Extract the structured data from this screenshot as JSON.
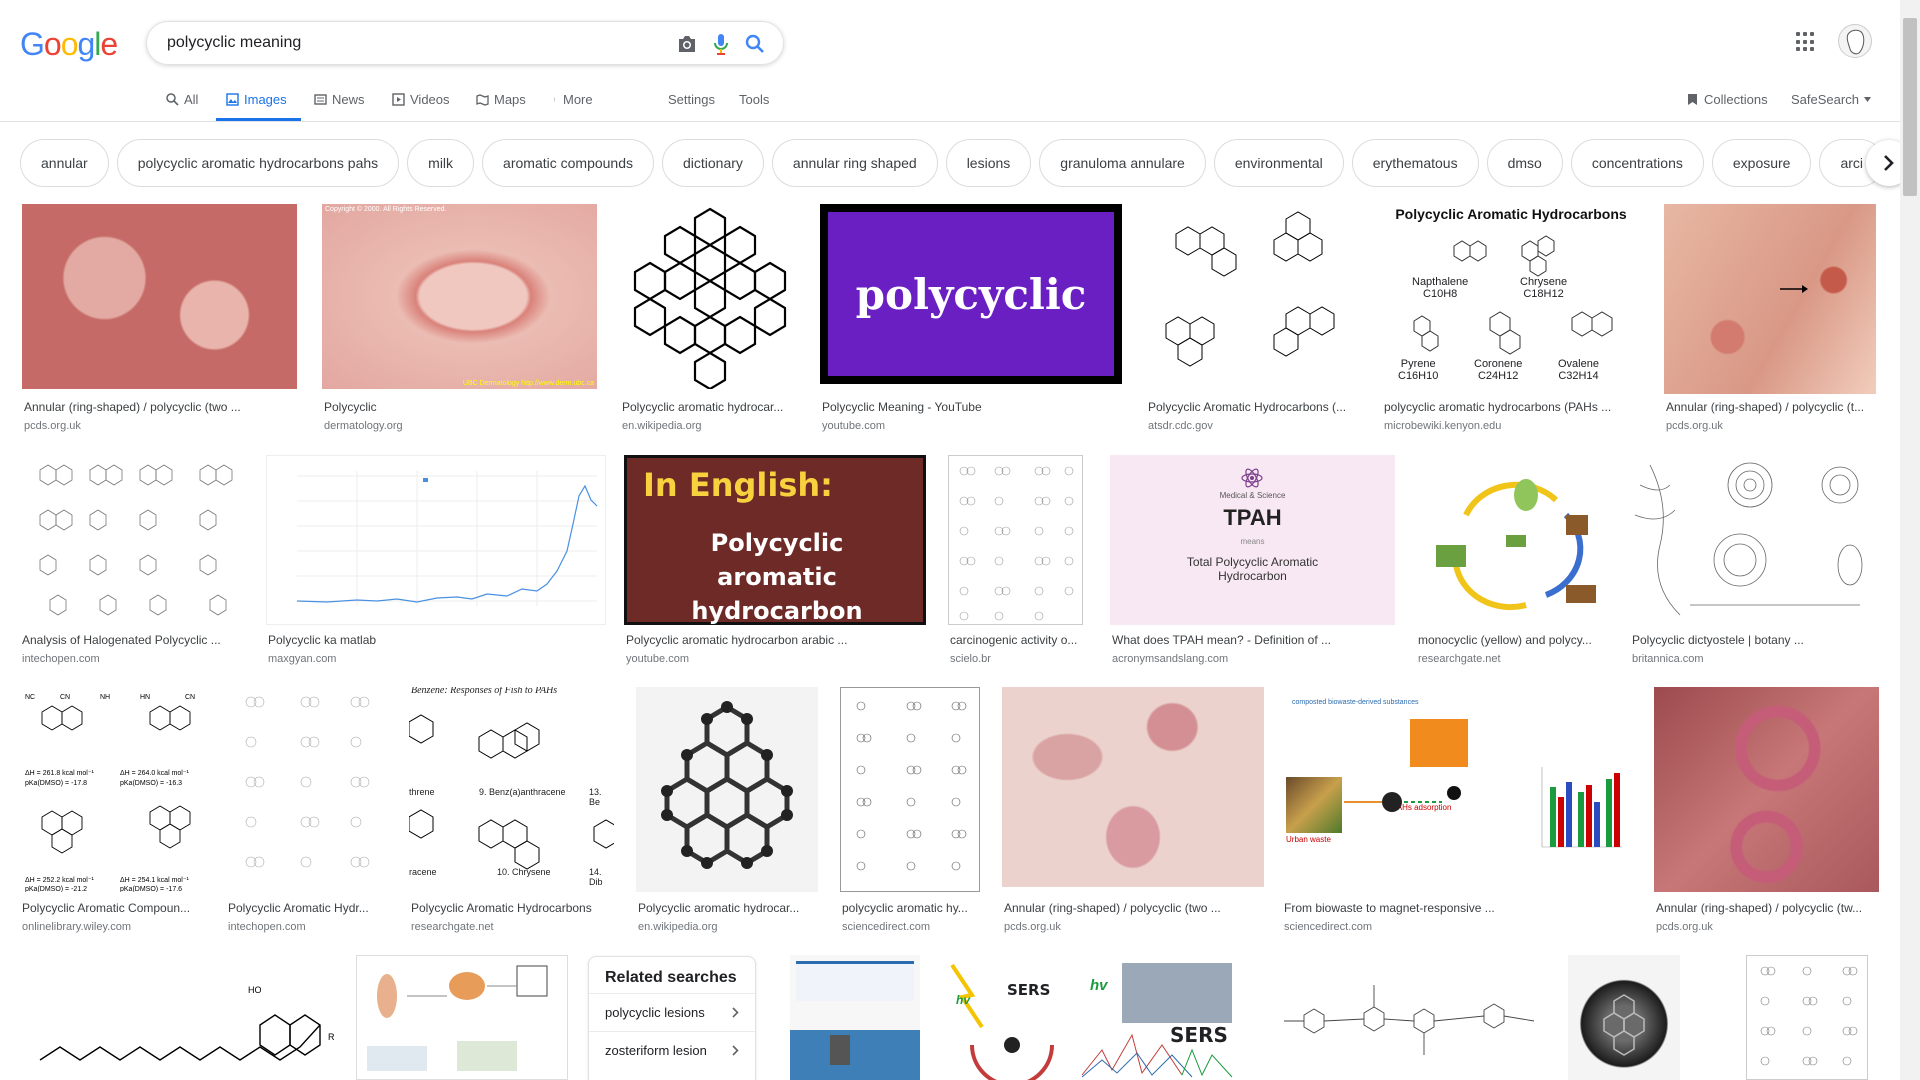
{
  "search": {
    "query": "polycyclic meaning"
  },
  "logo": {
    "letters": [
      "G",
      "o",
      "o",
      "g",
      "l",
      "e"
    ],
    "colors": [
      "#4285f4",
      "#ea4335",
      "#fbbc05",
      "#4285f4",
      "#34a853",
      "#ea4335"
    ]
  },
  "nav": {
    "tabs": [
      "All",
      "Images",
      "News",
      "Videos",
      "Maps",
      "More"
    ],
    "settings": "Settings",
    "tools": "Tools",
    "collections": "Collections",
    "safesearch": "SafeSearch"
  },
  "chips": [
    "annular",
    "polycyclic aromatic hydrocarbons pahs",
    "milk",
    "aromatic compounds",
    "dictionary",
    "annular ring shaped",
    "lesions",
    "granuloma annulare",
    "environmental",
    "erythematous",
    "dmso",
    "concentrations",
    "exposure",
    "arci"
  ],
  "results": [
    {
      "title": "Annular (ring-shaped) / polycyclic (two ...",
      "source": "pcds.org.uk"
    },
    {
      "title": "Polycyclic",
      "source": "dermatology.org",
      "overlay": "Copyright © 2000. All Rights Reserved.",
      "overlay2": "UBC Dermatology http://www.derm.ubc.ca"
    },
    {
      "title": "Polycyclic aromatic hydrocar...",
      "source": "en.wikipedia.org"
    },
    {
      "title": "Polycyclic Meaning - YouTube",
      "source": "youtube.com",
      "overlay": "polycyclic"
    },
    {
      "title": "Polycyclic Aromatic Hydrocarbons (...",
      "source": "atsdr.cdc.gov"
    },
    {
      "title": "polycyclic aromatic hydrocarbons (PAHs ...",
      "source": "microbewiki.kenyon.edu",
      "overlay": "Polycyclic Aromatic Hydrocarbons",
      "labels": [
        "Napthalene",
        "C10H8",
        "Chrysene",
        "C18H12",
        "Pyrene",
        "C16H10",
        "Coronene",
        "C24H12",
        "Ovalene",
        "C32H14"
      ]
    },
    {
      "title": "Annular (ring-shaped) / polycyclic (t...",
      "source": "pcds.org.uk"
    },
    {
      "title": "Analysis of Halogenated Polycyclic ...",
      "source": "intechopen.com"
    },
    {
      "title": "Polycyclic ka matlab",
      "source": "maxgyan.com"
    },
    {
      "title": "Polycyclic aromatic hydrocarbon arabic ...",
      "source": "youtube.com",
      "overlay": "In English:",
      "overlay2": "Polycyclic aromatic hydrocarbon"
    },
    {
      "title": "carcinogenic activity o...",
      "source": "scielo.br"
    },
    {
      "title": "What does TPAH mean? - Definition of ...",
      "source": "acronymsandslang.com",
      "overlay": "TPAH",
      "overlay2": "Total Polycyclic Aromatic Hydrocarbon",
      "overlay3": "Medical & Science",
      "overlay4": "means"
    },
    {
      "title": "monocyclic (yellow) and polycy...",
      "source": "researchgate.net"
    },
    {
      "title": "Polycyclic dictyostele | botany ...",
      "source": "britannica.com"
    },
    {
      "title": "Polycyclic Aromatic Compoun...",
      "source": "onlinelibrary.wiley.com"
    },
    {
      "title": "Polycyclic Aromatic Hydr...",
      "source": "intechopen.com"
    },
    {
      "title": "Polycyclic Aromatic Hydrocarbons",
      "source": "researchgate.net",
      "labels": [
        "Benzene: Responses of Fish to PAHs",
        "9. Benz(a)anthracene",
        "10. Chrysene",
        "13. Be",
        "14. Dib",
        "threne",
        "racene"
      ]
    },
    {
      "title": "Polycyclic aromatic hydrocar...",
      "source": "en.wikipedia.org"
    },
    {
      "title": "polycyclic aromatic hy...",
      "source": "sciencedirect.com"
    },
    {
      "title": "Annular (ring-shaped) / polycyclic (two ...",
      "source": "pcds.org.uk"
    },
    {
      "title": "From biowaste to magnet-responsive ...",
      "source": "sciencedirect.com",
      "labels": [
        "composted biowaste-derived substances",
        "Urban waste",
        "PAHs adsorption"
      ]
    },
    {
      "title": "Annular (ring-shaped) / polycyclic (tw...",
      "source": "pcds.org.uk"
    }
  ],
  "related": {
    "heading": "Related searches",
    "items": [
      "polycyclic lesions",
      "zosteriform lesion"
    ]
  },
  "bottom_labels": [
    "SERS",
    "SERS",
    "hv",
    "hv"
  ],
  "colors": {
    "accent": "#1a73e8",
    "skin": "#d9918a",
    "purple": "#6a1fc2",
    "maroon": "#6e2a26"
  }
}
